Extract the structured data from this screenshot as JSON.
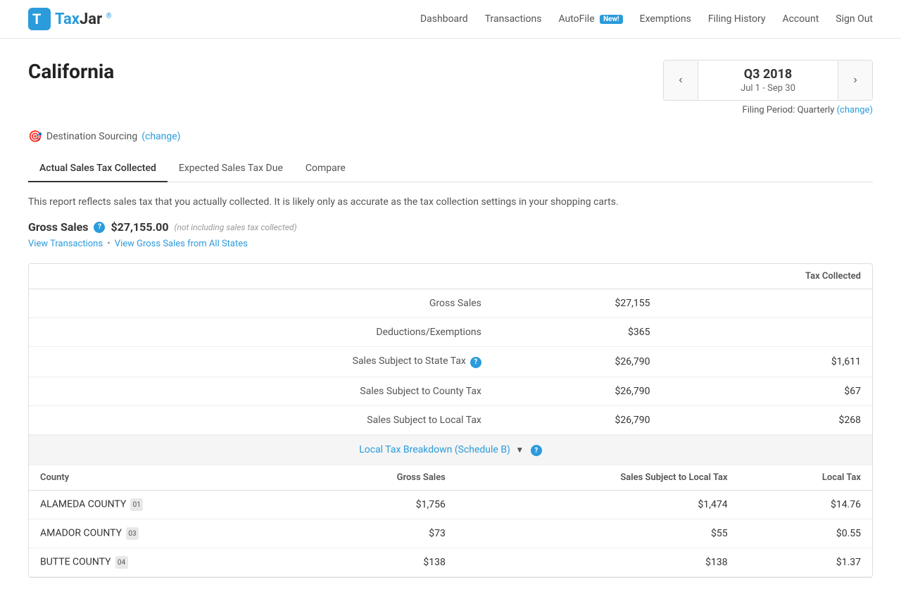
{
  "header": {
    "logo_text": "TaxJar",
    "nav_items": [
      {
        "label": "Dashboard",
        "badge": null
      },
      {
        "label": "Transactions",
        "badge": null
      },
      {
        "label": "AutoFile",
        "badge": "New!"
      },
      {
        "label": "Exemptions",
        "badge": null
      },
      {
        "label": "Filing History",
        "badge": null
      },
      {
        "label": "Account",
        "badge": null
      },
      {
        "label": "Sign Out",
        "badge": null
      }
    ]
  },
  "page": {
    "state": "California",
    "period": {
      "quarter": "Q3 2018",
      "dates": "Jul 1 - Sep 30"
    },
    "filing_period_label": "Filing Period: Quarterly",
    "filing_period_change": "(change)",
    "sourcing": {
      "label": "Destination Sourcing",
      "change": "(change)"
    },
    "tabs": [
      {
        "label": "Actual Sales Tax Collected",
        "active": true
      },
      {
        "label": "Expected Sales Tax Due",
        "active": false
      },
      {
        "label": "Compare",
        "active": false
      }
    ],
    "report_description": "This report reflects sales tax that you actually collected. It is likely only as accurate as the tax collection settings in your shopping carts.",
    "gross_sales": {
      "label": "Gross Sales",
      "amount": "$27,155.00",
      "note": "(not including sales tax collected)"
    },
    "links": {
      "view_transactions": "View Transactions",
      "view_gross_sales": "View Gross Sales from All States"
    },
    "table": {
      "header_col1": "",
      "header_col2": "",
      "header_col3": "Tax Collected",
      "rows": [
        {
          "label": "Gross Sales",
          "value": "$27,155",
          "tax": ""
        },
        {
          "label": "Deductions/Exemptions",
          "value": "$365",
          "tax": ""
        },
        {
          "label": "Sales Subject to State Tax",
          "value": "$26,790",
          "tax": "$1,611",
          "help": true
        },
        {
          "label": "Sales Subject to County Tax",
          "value": "$26,790",
          "tax": "$67"
        },
        {
          "label": "Sales Subject to Local Tax",
          "value": "$26,790",
          "tax": "$268"
        }
      ]
    },
    "schedule_b": {
      "label": "Local Tax Breakdown (Schedule B)",
      "county_table": {
        "headers": [
          "County",
          "Gross Sales",
          "Sales Subject to Local Tax",
          "Local Tax"
        ],
        "rows": [
          {
            "county": "ALAMEDA COUNTY",
            "badge": "01",
            "gross_sales": "$1,756",
            "subject": "$1,474",
            "local_tax": "$14.76"
          },
          {
            "county": "AMADOR COUNTY",
            "badge": "03",
            "gross_sales": "$73",
            "subject": "$55",
            "local_tax": "$0.55"
          },
          {
            "county": "BUTTE COUNTY",
            "badge": "04",
            "gross_sales": "$138",
            "subject": "$138",
            "local_tax": "$1.37"
          }
        ]
      }
    }
  }
}
